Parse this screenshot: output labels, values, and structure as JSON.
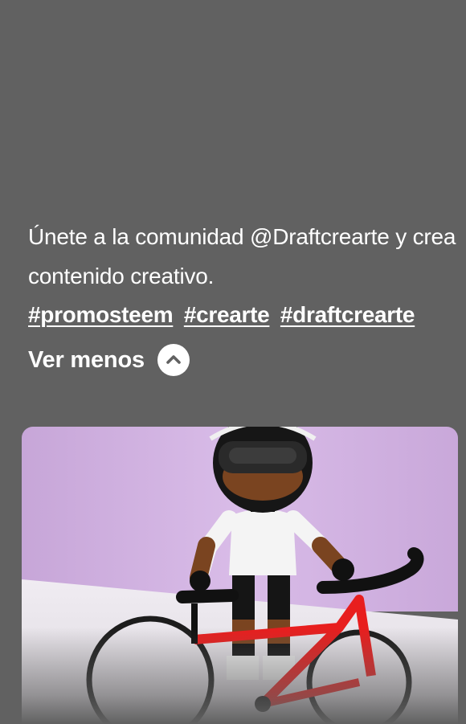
{
  "post": {
    "caption": "Únete a la comunidad @Draftcrearte y crea contenido creativo.",
    "hashtags": [
      "#promosteem",
      "#crearte",
      "#draftcrearte"
    ],
    "toggle_label": "Ver menos",
    "toggle_icon": "chevron-up-icon"
  },
  "colors": {
    "background": "#616161",
    "text": "#ffffff",
    "photo_wall": "#d9b8e6",
    "bike_frame": "#e81e1e"
  }
}
